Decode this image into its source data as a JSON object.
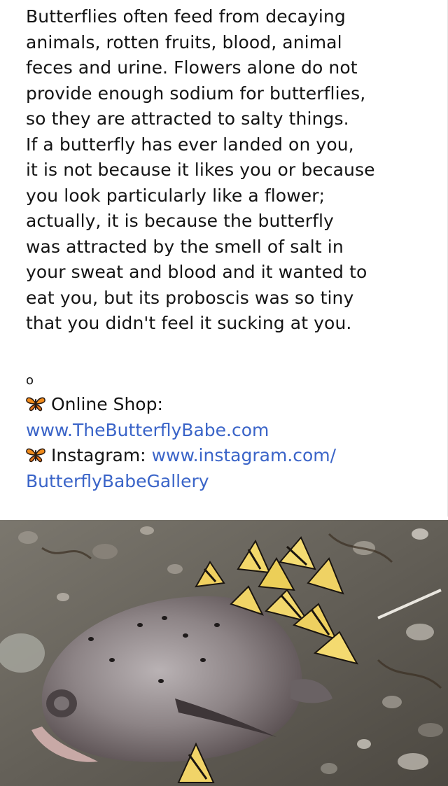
{
  "post": {
    "text_lines": [
      "Butterflies often feed from decaying",
      "animals, rotten fruits, blood, animal",
      "feces and urine. Flowers alone do not",
      "provide enough sodium for butterflies,",
      "so they are attracted to salty things.",
      "If a butterfly has ever landed on you,",
      "it is not because it likes you or because",
      "you look particularly like a flower;",
      "actually, it is because the butterfly",
      "was attracted by the smell of salt in",
      "your sweat and blood and it wanted to",
      "eat you, but its proboscis was so tiny",
      "that you didn't feel it sucking at you."
    ],
    "separator": "o",
    "shop_label": "Online Shop:",
    "shop_url": "www.TheButterflyBabe.com",
    "instagram_label": "Instagram:",
    "instagram_url_part1": "www.instagram.com/",
    "instagram_url_part2": "ButterflyBabeGallery",
    "emoji_icon": "butterfly-emoji-icon"
  },
  "photo": {
    "subject": "butterflies-on-dead-fish-photo"
  },
  "colors": {
    "text": "#141414",
    "link": "#3a64c8",
    "background": "#ffffff"
  }
}
